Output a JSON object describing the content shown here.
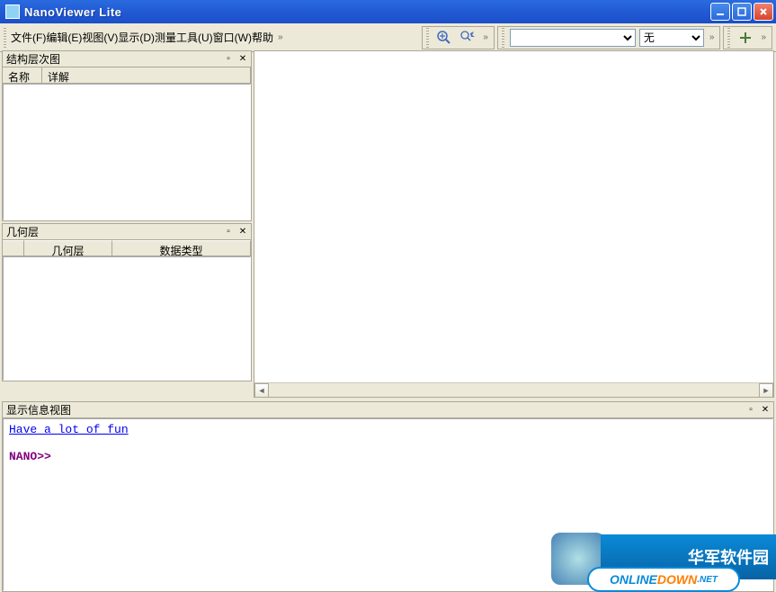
{
  "title": "NanoViewer Lite",
  "menu": {
    "file": "文件(F)",
    "edit": "编辑(E)",
    "view": "视图(V)",
    "display": "显示(D)",
    "measure": "测量工具(U)",
    "window": "窗口(W)",
    "help": "帮助"
  },
  "toolbar": {
    "zoom_in": "zoom-in",
    "zoom_select": "zoom-select",
    "combo1_value": "",
    "combo2_value": "无",
    "more": "»",
    "plus": "+"
  },
  "panels": {
    "structure": {
      "title": "结构层次图",
      "col_name": "名称",
      "col_detail": "详解"
    },
    "geometry": {
      "title": "几何层",
      "col_geom": "几何层",
      "col_type": "数据类型"
    },
    "info": {
      "title": "显示信息视图",
      "link_text": "Have a lot of fun",
      "prompt": "NANO>>"
    }
  },
  "watermark": {
    "banner_text": "华军软件园",
    "pill_1": "ONLINE",
    "pill_2": "DOWN",
    "pill_3": ".NET"
  }
}
